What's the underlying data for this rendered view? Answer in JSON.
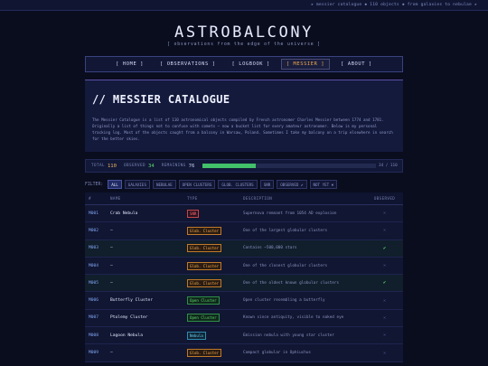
{
  "ticker": "★ messier catalogue ◆ 110 objects ◆ from galaxies to nebulae ★",
  "header": {
    "title": "ASTROBALCONY",
    "tagline": "[ observations from the edge of the universe ]"
  },
  "nav": {
    "items": [
      {
        "label": "[ HOME ]"
      },
      {
        "label": "[ OBSERVATIONS ]"
      },
      {
        "label": "[ LOGBOOK ]"
      },
      {
        "label": "[ MESSIER ]",
        "active": true
      },
      {
        "label": "[ ABOUT ]"
      }
    ]
  },
  "intro": {
    "heading": "// MESSIER CATALOGUE",
    "body": "The Messier Catalogue is a list of 110 astronomical objects compiled by French astronomer Charles Messier between 1774 and 1781. Originally a list of things not to confuse with comets — now a bucket list for every amateur astronomer. Below is my personal tracking log. Most of the objects caught from a balcony in Warsaw, Poland. Sometimes I take my balcony on a trip elsewhere in search for the better skies."
  },
  "stats": {
    "total_label": "TOTAL",
    "total": "110",
    "observed_label": "OBSERVED",
    "observed": "34",
    "remaining_label": "REMAINING",
    "remaining": "76",
    "progress_fraction": 0.309,
    "progress_text": "34 / 110"
  },
  "filter": {
    "label": "FILTER:",
    "chips": [
      {
        "label": "ALL",
        "active": true
      },
      {
        "label": "GALAXIES"
      },
      {
        "label": "NEBULAE"
      },
      {
        "label": "OPEN CLUSTERS"
      },
      {
        "label": "GLOB. CLUSTERS"
      },
      {
        "label": "SNR"
      },
      {
        "label": "OBSERVED ✔"
      },
      {
        "label": "NOT YET ✖"
      }
    ]
  },
  "table": {
    "headers": {
      "num": "#",
      "name": "NAME",
      "type": "TYPE",
      "desc": "DESCRIPTION",
      "obs": "OBSERVED"
    },
    "rows": [
      {
        "num": "M001",
        "name": "Crab Nebula",
        "type": "SNR",
        "type_class": "snr",
        "desc": "Supernova remnant from 1054 AD explosion",
        "obs": "✕",
        "observed": false
      },
      {
        "num": "M002",
        "name": "—",
        "type": "Glob. Cluster",
        "type_class": "glob",
        "desc": "One of the largest globular clusters",
        "obs": "✕",
        "observed": false
      },
      {
        "num": "M003",
        "name": "—",
        "type": "Glob. Cluster",
        "type_class": "glob",
        "desc": "Contains ~500,000 stars",
        "obs": "✔",
        "observed": true
      },
      {
        "num": "M004",
        "name": "—",
        "type": "Glob. Cluster",
        "type_class": "glob",
        "desc": "One of the closest globular clusters",
        "obs": "✕",
        "observed": false
      },
      {
        "num": "M005",
        "name": "—",
        "type": "Glob. Cluster",
        "type_class": "glob",
        "desc": "One of the oldest known globular clusters",
        "obs": "✔",
        "observed": true
      },
      {
        "num": "M006",
        "name": "Butterfly Cluster",
        "type": "Open Cluster",
        "type_class": "open",
        "desc": "Open cluster resembling a butterfly",
        "obs": "✕",
        "observed": false
      },
      {
        "num": "M007",
        "name": "Ptolemy Cluster",
        "type": "Open Cluster",
        "type_class": "open",
        "desc": "Known since antiquity, visible to naked eye",
        "obs": "✕",
        "observed": false
      },
      {
        "num": "M008",
        "name": "Lagoon Nebula",
        "type": "Nebula",
        "type_class": "neb",
        "desc": "Emission nebula with young star cluster",
        "obs": "✕",
        "observed": false
      },
      {
        "num": "M009",
        "name": "—",
        "type": "Glob. Cluster",
        "type_class": "glob",
        "desc": "Compact globular in Ophiuchus",
        "obs": "✕",
        "observed": false
      }
    ]
  }
}
